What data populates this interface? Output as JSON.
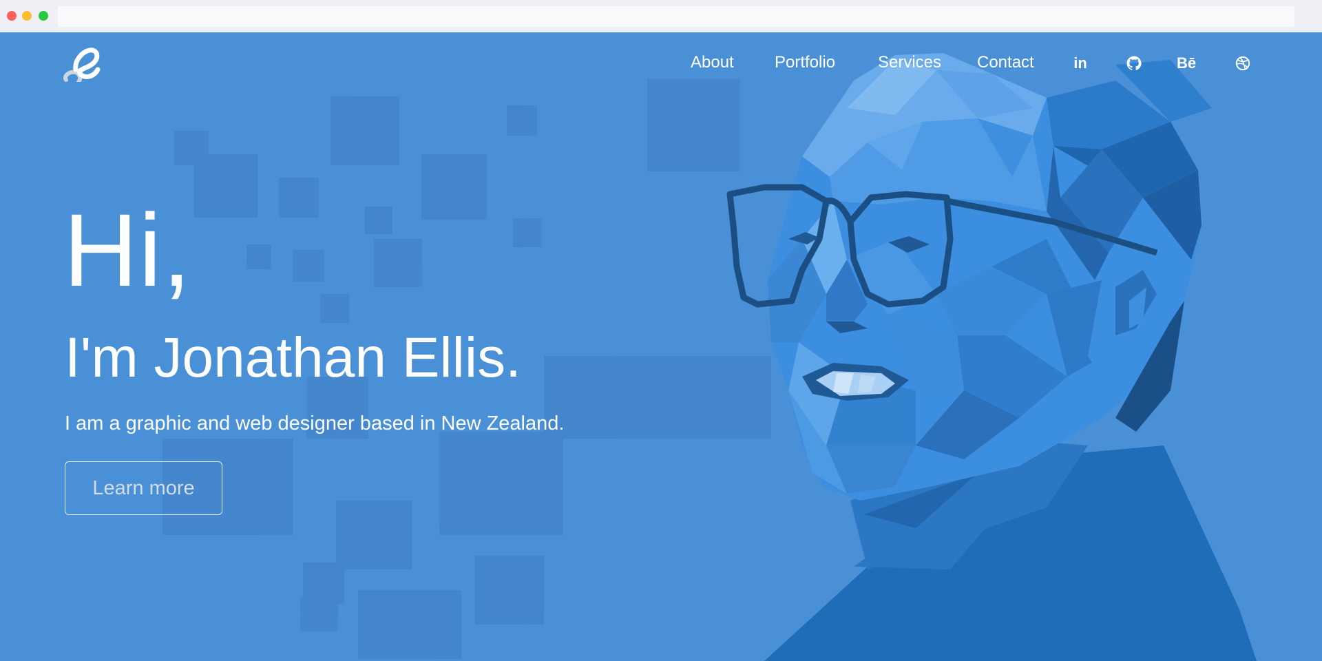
{
  "colors": {
    "hero_background": "#4a90d6",
    "text": "#ffffff",
    "button_text": "#d3dce6",
    "portrait_dark": "#1b4f83"
  },
  "logo": {
    "icon": "je-monogram-logo"
  },
  "nav": {
    "links": [
      "About",
      "Portfolio",
      "Services",
      "Contact"
    ],
    "social_icons": [
      "linkedin-icon",
      "github-icon",
      "behance-icon",
      "dribbble-icon"
    ],
    "linkedin_text": "in",
    "behance_text": "Bē"
  },
  "hero": {
    "greeting": "Hi,",
    "name": "I'm Jonathan Ellis.",
    "tagline": "I am a graphic and web designer based in New Zealand.",
    "cta_label": "Learn more"
  }
}
